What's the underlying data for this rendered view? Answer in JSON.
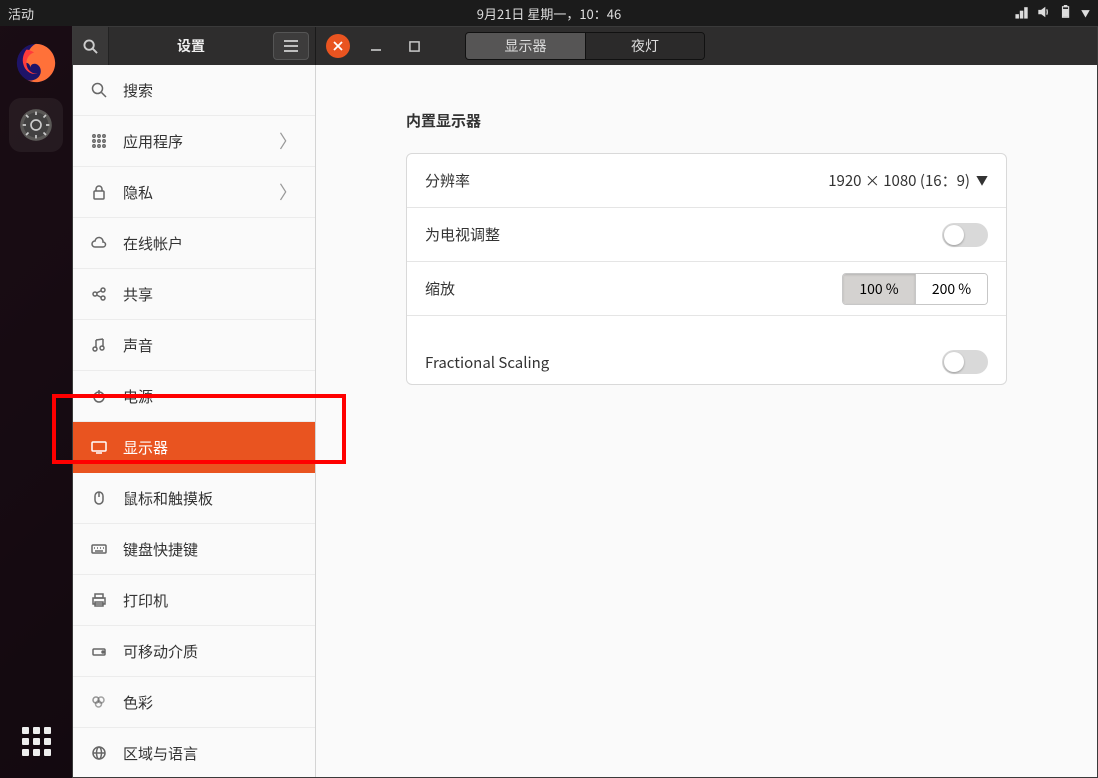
{
  "topbar": {
    "activities": "活动",
    "datetime": "9月21日 星期一，10：46"
  },
  "window": {
    "title": "设置",
    "tabs": {
      "displays": "显示器",
      "nightlight": "夜灯"
    }
  },
  "sidebar": {
    "search": "搜索",
    "apps": "应用程序",
    "privacy": "隐私",
    "online_accounts": "在线帐户",
    "sharing": "共享",
    "sound": "声音",
    "power": "电源",
    "displays": "显示器",
    "mouse": "鼠标和触摸板",
    "keyboard": "键盘快捷键",
    "printers": "打印机",
    "removable": "可移动介质",
    "color": "色彩",
    "region": "区域与语言"
  },
  "main": {
    "section_title": "内置显示器",
    "resolution": {
      "label": "分辨率",
      "value": "1920 × 1080 (16：9)"
    },
    "tv_adjust": {
      "label": "为电视调整"
    },
    "scale": {
      "label": "缩放",
      "opt100": "100 %",
      "opt200": "200 %"
    },
    "fractional": {
      "label": "Fractional Scaling"
    }
  }
}
